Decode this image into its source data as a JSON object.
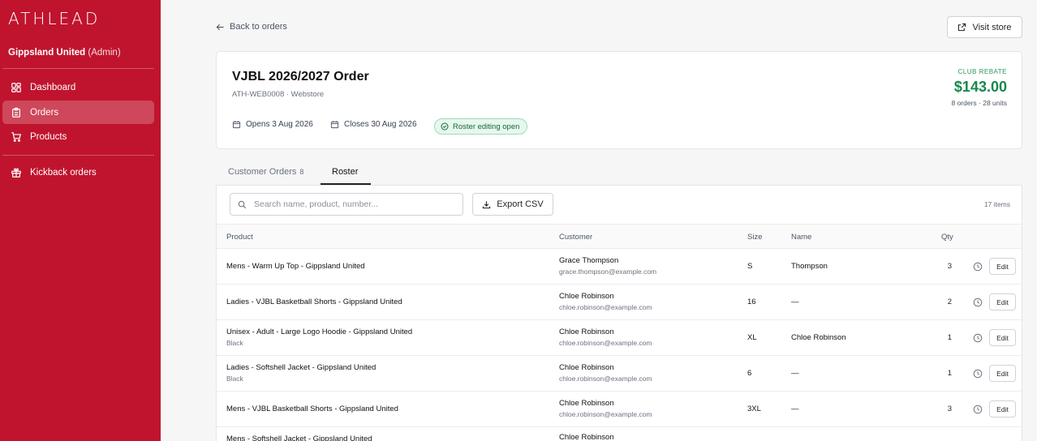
{
  "sidebar": {
    "logo": "ATHLEAD",
    "org_name": "Gippsland United",
    "org_role": "(Admin)",
    "items": [
      {
        "label": "Dashboard",
        "icon": "dashboard-icon"
      },
      {
        "label": "Orders",
        "icon": "clipboard-icon",
        "active": true
      },
      {
        "label": "Products",
        "icon": "cart-icon"
      },
      {
        "label": "Kickback orders",
        "icon": "gift-icon"
      }
    ]
  },
  "header": {
    "back_label": "Back to orders",
    "visit_label": "Visit store"
  },
  "order": {
    "title": "VJBL 2026/2027 Order",
    "subtitle": "ATH-WEB0008 · Webstore",
    "opens": "Opens 3 Aug 2026",
    "closes": "Closes 30 Aug 2026",
    "status": "Roster editing open",
    "rebate_label": "CLUB REBATE",
    "rebate_value": "$143.00",
    "rebate_sub": "8 orders · 28 units"
  },
  "tabs": [
    {
      "label": "Customer Orders",
      "count": "8"
    },
    {
      "label": "Roster",
      "active": true
    }
  ],
  "toolbar": {
    "search_placeholder": "Search name, product, number...",
    "export_label": "Export CSV",
    "items_count": "17 items"
  },
  "table": {
    "headers": {
      "product": "Product",
      "customer": "Customer",
      "size": "Size",
      "name": "Name",
      "qty": "Qty"
    },
    "edit_label": "Edit",
    "rows": [
      {
        "product": "Mens - Warm Up Top - Gippsland United",
        "variant": "",
        "customer": "Grace Thompson",
        "email": "grace.thompson@example.com",
        "size": "S",
        "name": "Thompson",
        "qty": "3"
      },
      {
        "product": "Ladies - VJBL Basketball Shorts - Gippsland United",
        "variant": "",
        "customer": "Chloe Robinson",
        "email": "chloe.robinson@example.com",
        "size": "16",
        "name": "—",
        "qty": "2"
      },
      {
        "product": "Unisex - Adult - Large Logo Hoodie - Gippsland United",
        "variant": "Black",
        "customer": "Chloe Robinson",
        "email": "chloe.robinson@example.com",
        "size": "XL",
        "name": "Chloe Robinson",
        "qty": "1"
      },
      {
        "product": "Ladies - Softshell Jacket - Gippsland United",
        "variant": "Black",
        "customer": "Chloe Robinson",
        "email": "chloe.robinson@example.com",
        "size": "6",
        "name": "—",
        "qty": "1"
      },
      {
        "product": "Mens - VJBL Basketball Shorts - Gippsland United",
        "variant": "",
        "customer": "Chloe Robinson",
        "email": "chloe.robinson@example.com",
        "size": "3XL",
        "name": "—",
        "qty": "3"
      },
      {
        "product": "Mens - Softshell Jacket - Gippsland United",
        "variant": "",
        "customer": "Chloe Robinson",
        "email": "",
        "size": "",
        "name": "",
        "qty": ""
      }
    ]
  },
  "colors": {
    "brand": "#c0142e",
    "rebate": "#19884e",
    "badge_bg": "#e7f7ee"
  }
}
